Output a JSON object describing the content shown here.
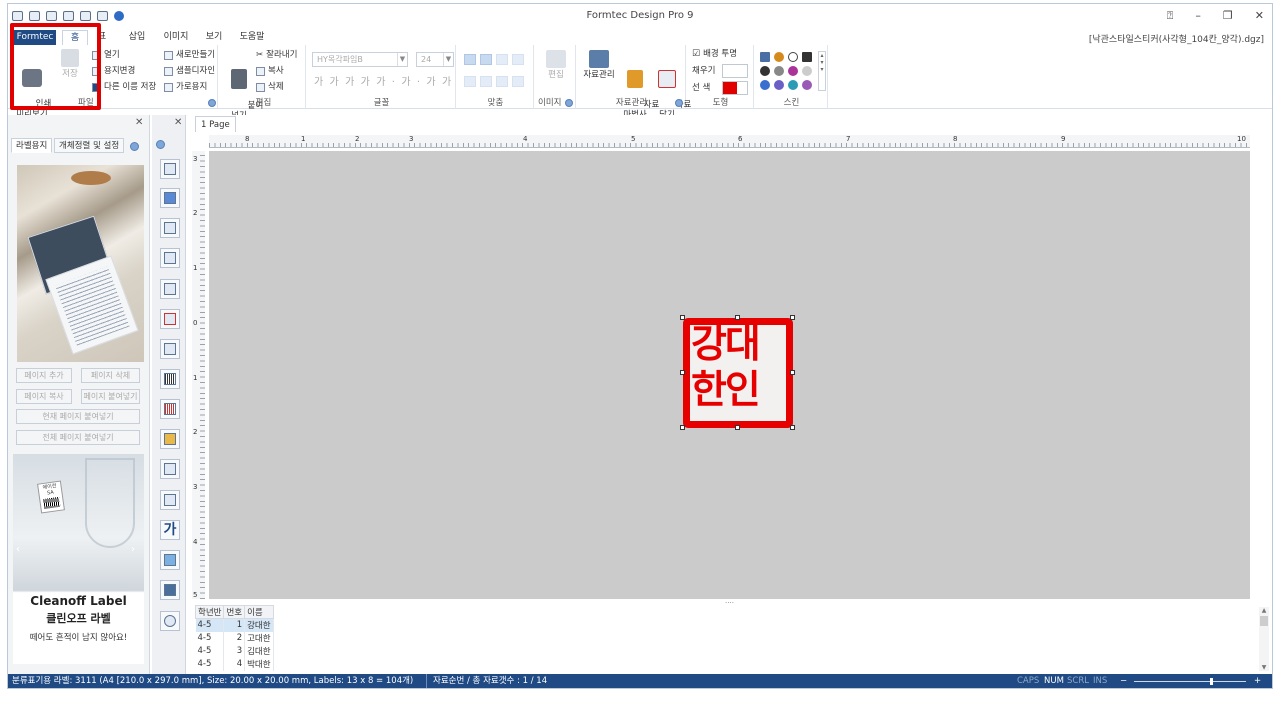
{
  "window": {
    "title": "Formtec Design Pro 9",
    "file_path": "[낙관스타일스티커(사각형_104칸_양각).dgz]"
  },
  "ribbon_tabs": [
    "Formtec",
    "홈",
    "표",
    "삽입",
    "이미지",
    "보기",
    "도움말"
  ],
  "file_group": {
    "print_preview": "인쇄\n미리보기",
    "save": "저장",
    "open": "열기",
    "change_paper": "용지변경",
    "save_as": "다른 이름 저장",
    "new": "새로만들기",
    "sample_design": "샘플디자인",
    "landscape": "가로용지",
    "group_label": "파일"
  },
  "edit_group": {
    "paste": "붙여\n넣기",
    "cut": "잘라내기",
    "copy": "복사",
    "delete": "삭제",
    "label": "편집"
  },
  "font_group": {
    "font_name": "HY목각파임B",
    "font_size": "24",
    "label": "글꼴"
  },
  "align_group": {
    "label": "맞춤"
  },
  "image_group": {
    "edit": "편집",
    "label": "이미지"
  },
  "data_group": {
    "data_manage": "자료관리",
    "wizard": "자료\n마법사",
    "close": "자료\n닫기",
    "label": "자료관리"
  },
  "shape_group": {
    "bg_transparent": "배경 투명",
    "fill": "채우기",
    "line_color": "선  색",
    "label": "도형"
  },
  "skin_group": {
    "label": "스킨"
  },
  "left_panel": {
    "tabs": [
      "라벨용지",
      "개체정렬 및 설정"
    ],
    "buttons": [
      "페이지 추가",
      "페이지 삭제",
      "페이지 복사",
      "페이지 붙여넣기",
      "현재 페이지 붙여넣기",
      "전체 페이지 붙여넣기"
    ],
    "ad_brand": "Cleanoff Label",
    "ad_title": "클린오프 라벨",
    "ad_caption": "떼어도 흔적이 남지 않아요!",
    "ad_sticker_text": "에이전 SA"
  },
  "page_tab": "1 Page",
  "ruler_h": [
    "8",
    "1",
    "2",
    "3",
    "4",
    "5",
    "6",
    "7",
    "8",
    "9",
    "10"
  ],
  "ruler_v": [
    "3",
    "2",
    "1",
    "0",
    "1",
    "2",
    "3",
    "4",
    "5"
  ],
  "stamp": {
    "line1": "강대",
    "line2": "한인",
    "color": "#e60000"
  },
  "grid": {
    "headers": [
      "학년반",
      "번호",
      "이름"
    ],
    "rows": [
      [
        "4-5",
        "1",
        "강대한"
      ],
      [
        "4-5",
        "2",
        "고대한"
      ],
      [
        "4-5",
        "3",
        "김대한"
      ],
      [
        "4-5",
        "4",
        "박대한"
      ]
    ]
  },
  "status": {
    "paper": "분류표기용 라벨: 3111 (A4 [210.0 x 297.0 mm], Size: 20.00 x 20.00 mm,  Labels: 13 x 8 = 104개)",
    "record": "자료순번 / 총 자료갯수 : 1 / 14",
    "caps": "CAPS",
    "num": "NUM",
    "scrl": "SCRL",
    "ins": "INS",
    "zoom_minus": "−",
    "zoom_plus": "+"
  },
  "colors": {
    "accent": "#1f4a84",
    "highlight": "#e00000",
    "stamp_red": "#e60000"
  }
}
